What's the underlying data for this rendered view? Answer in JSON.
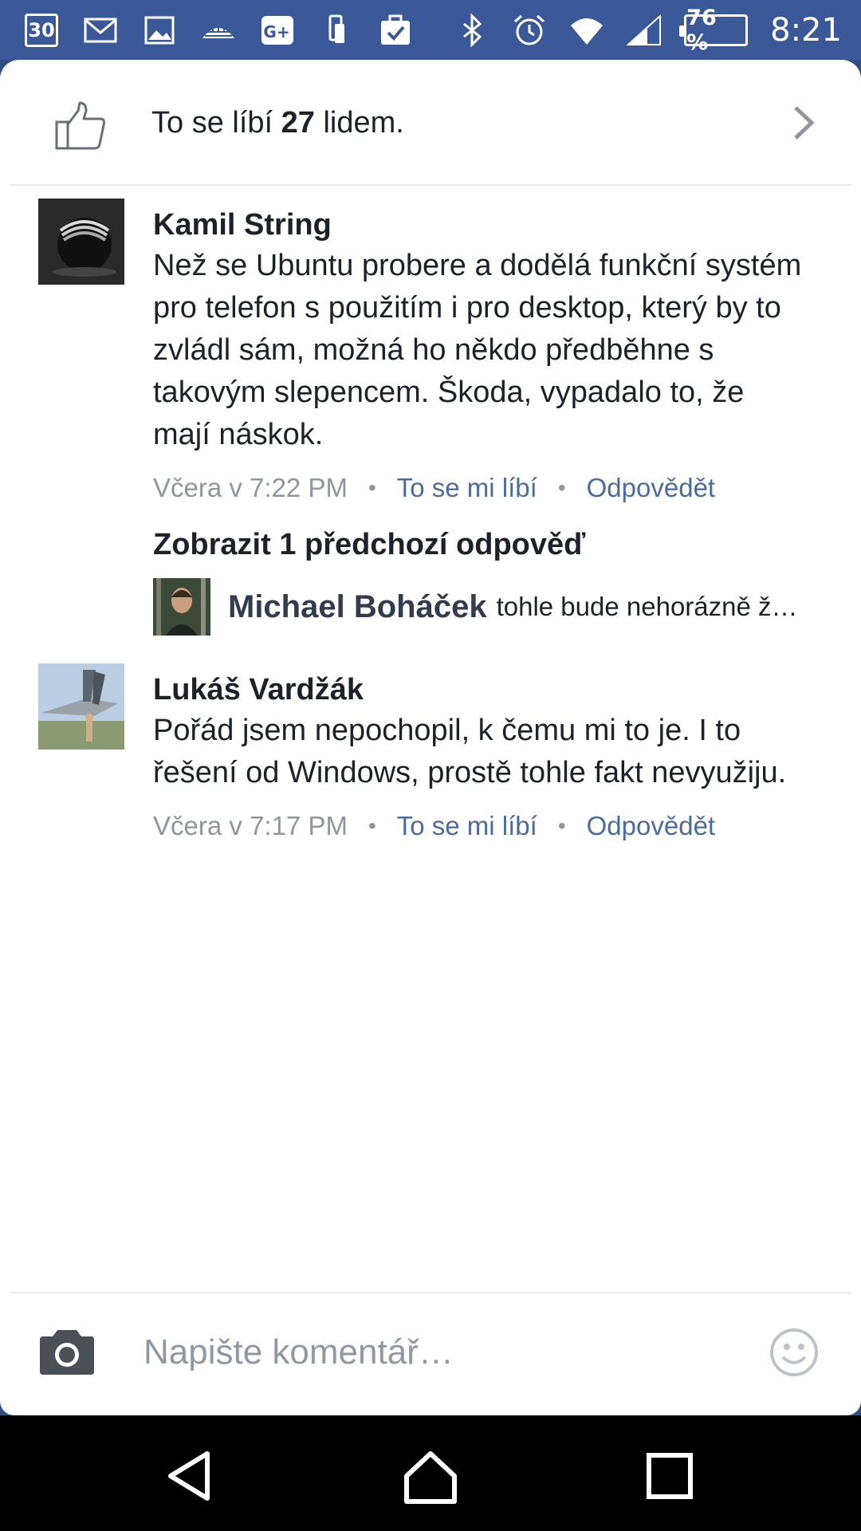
{
  "status_bar": {
    "calendar_day": "30",
    "battery": "76 %",
    "time": "8:21",
    "left_icons": [
      "calendar-icon",
      "gmail-icon",
      "gallery-icon",
      "igloo-icon",
      "google-plus-icon",
      "phone-transfer-icon",
      "clipboard-check-icon"
    ],
    "right_icons": [
      "bluetooth-icon",
      "alarm-icon",
      "wifi-icon",
      "signal-icon",
      "battery-icon"
    ]
  },
  "likes": {
    "prefix": "To se líbí ",
    "count": "27",
    "suffix": " lidem."
  },
  "comments": [
    {
      "author": "Kamil String",
      "text": "Než se Ubuntu probere a dodělá funkční systém pro telefon s použitím i pro desktop, který by to zvládl sám, možná ho někdo předběhne s takovým slepencem. Škoda, vypadalo to, že mají náskok.",
      "time": "Včera v 7:22 PM",
      "like_label": "To se mi líbí",
      "reply_label": "Odpovědět"
    },
    {
      "author": "Lukáš Vardžák",
      "text": "Pořád jsem nepochopil, k čemu mi to je. I to řešení od Windows, prostě tohle fakt nevyužiju.",
      "time": "Včera v 7:17 PM",
      "like_label": "To se mi líbí",
      "reply_label": "Odpovědět"
    }
  ],
  "previous_replies_label": "Zobrazit 1 předchozí odpověď",
  "reply": {
    "author": "Michael Boháček",
    "text": "tohle bude nehorázně ž…"
  },
  "composer": {
    "placeholder": "Napište komentář…"
  },
  "colors": {
    "status_bar": "#3b5998",
    "link": "#4b6b9f",
    "meta": "#90949c"
  }
}
